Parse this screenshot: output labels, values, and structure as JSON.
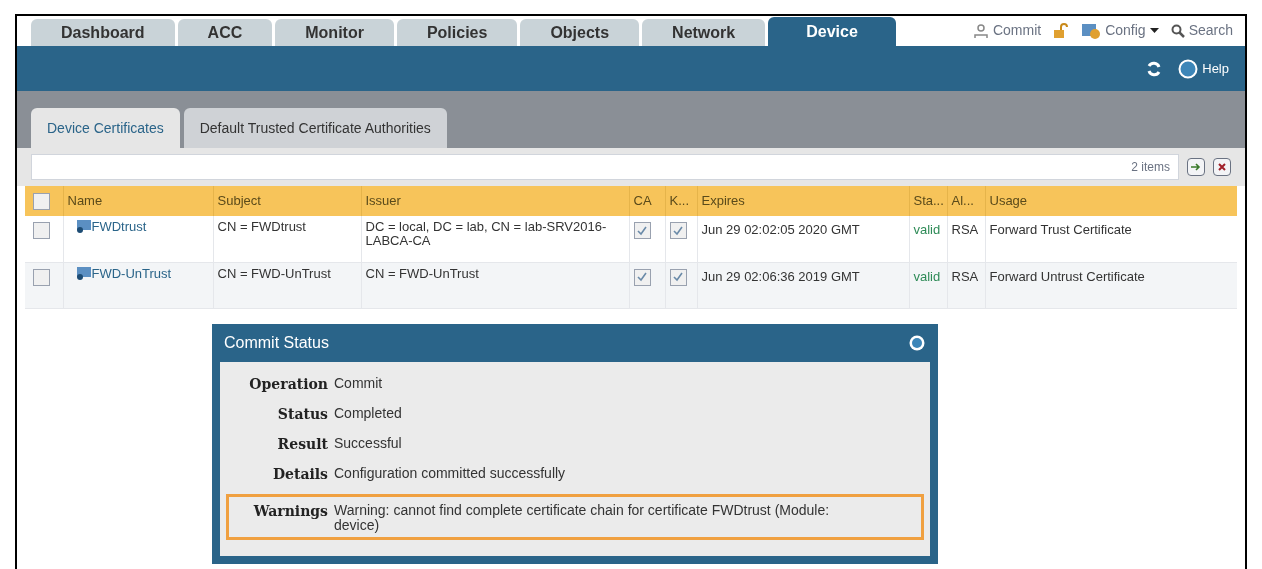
{
  "main_tabs": [
    {
      "label": "Dashboard",
      "selected": false
    },
    {
      "label": "ACC",
      "selected": false
    },
    {
      "label": "Monitor",
      "selected": false
    },
    {
      "label": "Policies",
      "selected": false
    },
    {
      "label": "Objects",
      "selected": false
    },
    {
      "label": "Network",
      "selected": false
    },
    {
      "label": "Device",
      "selected": true
    }
  ],
  "header_actions": [
    {
      "kind": "commit",
      "label": "Commit"
    },
    {
      "kind": "lock"
    },
    {
      "kind": "config",
      "label": "Config"
    },
    {
      "kind": "search",
      "label": "Search"
    }
  ],
  "toolbar": {
    "help": "Help"
  },
  "sub_tabs": [
    {
      "label": "Device Certificates",
      "selected": true
    },
    {
      "label": "Default Trusted Certificate Authorities",
      "selected": false
    }
  ],
  "filter": {
    "count": "2 items"
  },
  "table": {
    "select_all": false,
    "columns": [
      "Name",
      "Subject",
      "Issuer",
      "CA",
      "K...",
      "Expires",
      "Sta...",
      "Al...",
      "Usage"
    ],
    "rows": [
      {
        "selected": false,
        "name": "FWDtrust",
        "subject": "CN = FWDtrust",
        "issuer": "DC = local, DC = lab, CN = lab-SRV2016-LABCA-CA",
        "ca": true,
        "key": true,
        "expires": "Jun 29 02:02:05 2020 GMT",
        "status": "valid",
        "algorithm": "RSA",
        "usage": "Forward Trust Certificate"
      },
      {
        "selected": false,
        "name": "FWD-UnTrust",
        "subject": "CN = FWD-UnTrust",
        "issuer": "CN = FWD-UnTrust",
        "ca": true,
        "key": true,
        "expires": "Jun 29 02:06:36 2019 GMT",
        "status": "valid",
        "algorithm": "RSA",
        "usage": "Forward Untrust Certificate"
      }
    ]
  },
  "dialog": {
    "title": "Commit Status",
    "fields": [
      {
        "label": "Operation",
        "value": "Commit",
        "highlighted": false
      },
      {
        "label": "Status",
        "value": "Completed",
        "highlighted": false
      },
      {
        "label": "Result",
        "value": "Successful",
        "highlighted": false
      },
      {
        "label": "Details",
        "value": "Configuration committed successfully",
        "highlighted": false
      },
      {
        "label": "Warnings",
        "value": "Warning: cannot find complete certificate chain for certificate FWDtrust (Module: device)",
        "highlighted": true
      }
    ]
  }
}
